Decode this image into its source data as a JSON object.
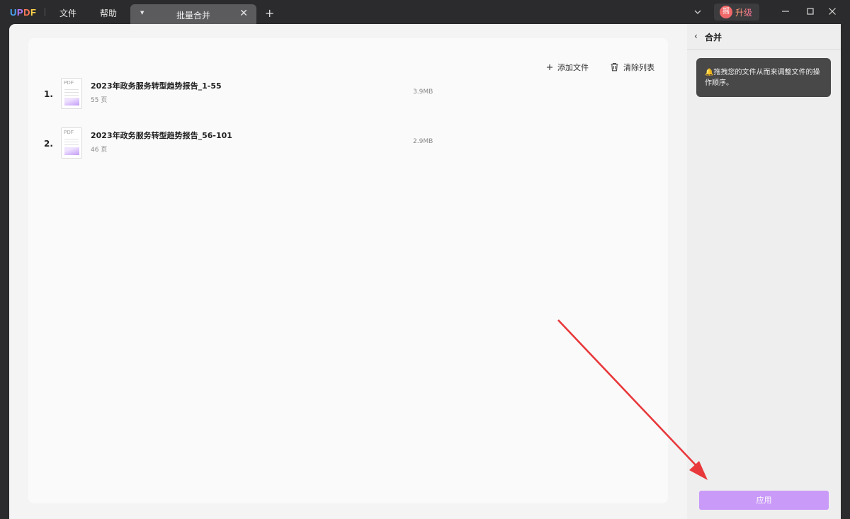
{
  "titlebar": {
    "logo": {
      "u": "U",
      "p": "P",
      "d": "D",
      "f": "F"
    },
    "menus": [
      "文件",
      "帮助"
    ],
    "tab_label": "批量合并",
    "upgrade_avatar": "摇",
    "upgrade_label": "升级"
  },
  "toolbar": {
    "add_files": "添加文件",
    "clear_list": "清除列表"
  },
  "files": [
    {
      "index": "1.",
      "name": "2023年政务服务转型趋势报告_1-55",
      "pages": "55 页",
      "size": "3.9MB"
    },
    {
      "index": "2.",
      "name": "2023年政务服务转型趋势报告_56-101",
      "pages": "46 页",
      "size": "2.9MB"
    }
  ],
  "thumbnail_tag": "PDF",
  "panel": {
    "title": "合并",
    "tip": "拖拽您的文件从而来调整文件的操作顺序。",
    "apply_label": "应用"
  },
  "colors": {
    "titlebar_bg": "#2b2b2d",
    "apply_button": "#c99af8",
    "annotation_arrow": "#e8383b"
  },
  "icons": [
    "updf-logo",
    "chevron-down-icon",
    "close-icon",
    "plus-icon",
    "minimize-icon",
    "maximize-icon",
    "window-close-icon",
    "trash-icon",
    "chevron-left-icon",
    "bell-icon",
    "pdf-file-icon"
  ]
}
